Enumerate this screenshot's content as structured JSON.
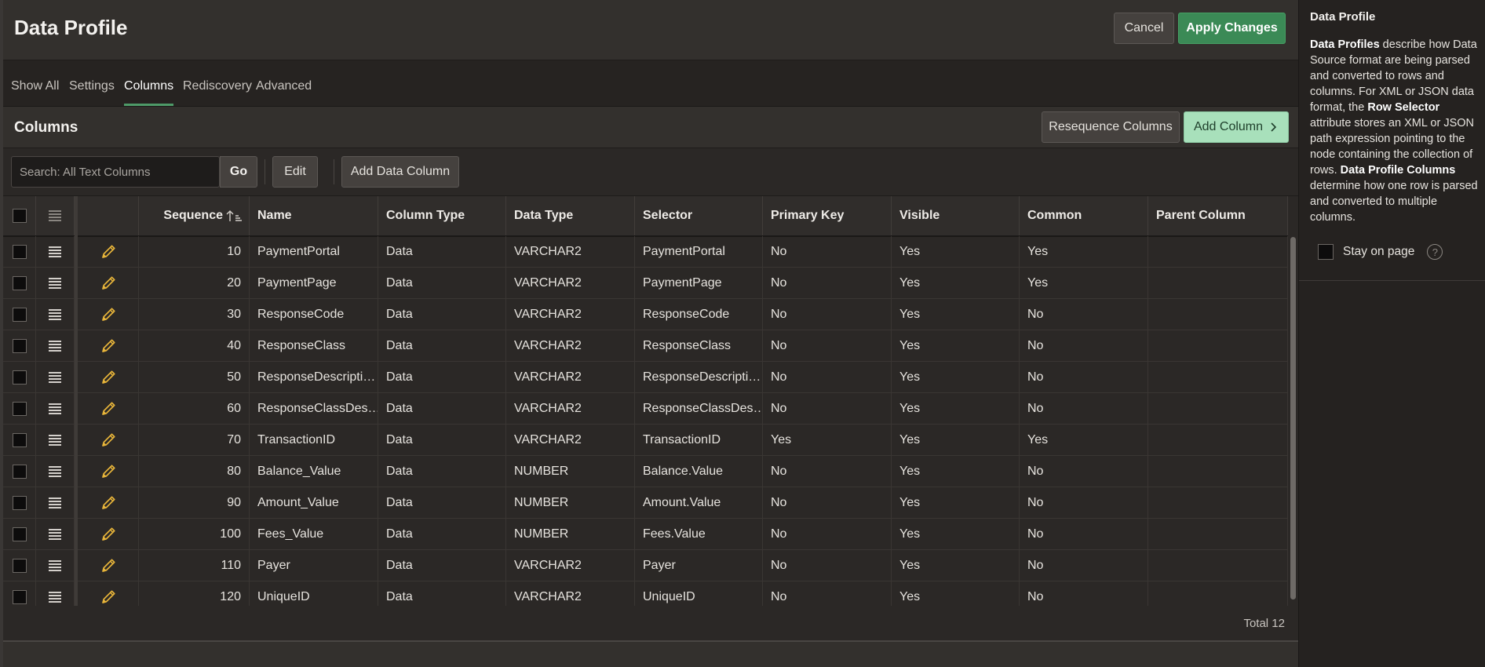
{
  "header": {
    "title": "Data Profile",
    "cancel_label": "Cancel",
    "apply_label": "Apply Changes"
  },
  "tabs": [
    {
      "label": "Show All"
    },
    {
      "label": "Settings"
    },
    {
      "label": "Columns"
    },
    {
      "label": "Rediscovery"
    },
    {
      "label": "Advanced"
    }
  ],
  "active_tab": "Columns",
  "region": {
    "title": "Columns",
    "resequence_label": "Resequence Columns",
    "add_column_label": "Add Column"
  },
  "toolbar": {
    "search_placeholder": "Search: All Text Columns",
    "go_label": "Go",
    "edit_label": "Edit",
    "add_data_column_label": "Add Data Column"
  },
  "grid": {
    "columns": [
      "Sequence",
      "Name",
      "Column Type",
      "Data Type",
      "Selector",
      "Primary Key",
      "Visible",
      "Common",
      "Parent Column"
    ],
    "rows": [
      {
        "seq": "10",
        "name": "PaymentPortal",
        "ctype": "Data",
        "dtype": "VARCHAR2",
        "selector": "PaymentPortal",
        "pk": "No",
        "visible": "Yes",
        "common": "Yes",
        "parent": ""
      },
      {
        "seq": "20",
        "name": "PaymentPage",
        "ctype": "Data",
        "dtype": "VARCHAR2",
        "selector": "PaymentPage",
        "pk": "No",
        "visible": "Yes",
        "common": "Yes",
        "parent": ""
      },
      {
        "seq": "30",
        "name": "ResponseCode",
        "ctype": "Data",
        "dtype": "VARCHAR2",
        "selector": "ResponseCode",
        "pk": "No",
        "visible": "Yes",
        "common": "No",
        "parent": ""
      },
      {
        "seq": "40",
        "name": "ResponseClass",
        "ctype": "Data",
        "dtype": "VARCHAR2",
        "selector": "ResponseClass",
        "pk": "No",
        "visible": "Yes",
        "common": "No",
        "parent": ""
      },
      {
        "seq": "50",
        "name": "ResponseDescripti…",
        "ctype": "Data",
        "dtype": "VARCHAR2",
        "selector": "ResponseDescripti…",
        "pk": "No",
        "visible": "Yes",
        "common": "No",
        "parent": ""
      },
      {
        "seq": "60",
        "name": "ResponseClassDes…",
        "ctype": "Data",
        "dtype": "VARCHAR2",
        "selector": "ResponseClassDes…",
        "pk": "No",
        "visible": "Yes",
        "common": "No",
        "parent": ""
      },
      {
        "seq": "70",
        "name": "TransactionID",
        "ctype": "Data",
        "dtype": "VARCHAR2",
        "selector": "TransactionID",
        "pk": "Yes",
        "visible": "Yes",
        "common": "Yes",
        "parent": ""
      },
      {
        "seq": "80",
        "name": "Balance_Value",
        "ctype": "Data",
        "dtype": "NUMBER",
        "selector": "Balance.Value",
        "pk": "No",
        "visible": "Yes",
        "common": "No",
        "parent": ""
      },
      {
        "seq": "90",
        "name": "Amount_Value",
        "ctype": "Data",
        "dtype": "NUMBER",
        "selector": "Amount.Value",
        "pk": "No",
        "visible": "Yes",
        "common": "No",
        "parent": ""
      },
      {
        "seq": "100",
        "name": "Fees_Value",
        "ctype": "Data",
        "dtype": "NUMBER",
        "selector": "Fees.Value",
        "pk": "No",
        "visible": "Yes",
        "common": "No",
        "parent": ""
      },
      {
        "seq": "110",
        "name": "Payer",
        "ctype": "Data",
        "dtype": "VARCHAR2",
        "selector": "Payer",
        "pk": "No",
        "visible": "Yes",
        "common": "No",
        "parent": ""
      },
      {
        "seq": "120",
        "name": "UniqueID",
        "ctype": "Data",
        "dtype": "VARCHAR2",
        "selector": "UniqueID",
        "pk": "No",
        "visible": "Yes",
        "common": "No",
        "parent": ""
      }
    ],
    "total": "Total 12"
  },
  "help": {
    "title": "Data Profile",
    "stay_label": "Stay on page"
  },
  "icons": [
    "checkbox-icon",
    "row-menu-icon",
    "pencil-edit-icon",
    "sort-ascending-icon",
    "chevron-right-icon",
    "help-icon"
  ],
  "colors": {
    "accent_green": "#3b8a56",
    "add_column_bg": "#a8e0bb",
    "pencil": "#e8b53a",
    "background": "#2b2826"
  }
}
